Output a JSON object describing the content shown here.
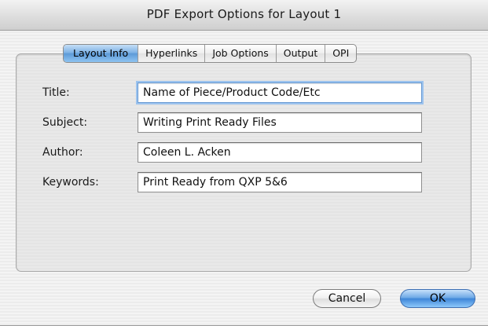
{
  "window": {
    "title": "PDF Export Options for Layout 1"
  },
  "tabs": [
    {
      "label": "Layout Info",
      "active": true
    },
    {
      "label": "Hyperlinks",
      "active": false
    },
    {
      "label": "Job Options",
      "active": false
    },
    {
      "label": "Output",
      "active": false
    },
    {
      "label": "OPI",
      "active": false
    }
  ],
  "fields": {
    "title": {
      "label": "Title:",
      "value": "Name of Piece/Product Code/Etc"
    },
    "subject": {
      "label": "Subject:",
      "value": "Writing Print Ready Files"
    },
    "author": {
      "label": "Author:",
      "value": "Coleen L. Acken"
    },
    "keywords": {
      "label": "Keywords:",
      "value": "Print Ready from QXP 5&6"
    }
  },
  "buttons": {
    "cancel_label": "Cancel",
    "ok_label": "OK"
  },
  "colors": {
    "accent": "#5d9ad8",
    "focus_ring": "#9cc3ee"
  }
}
